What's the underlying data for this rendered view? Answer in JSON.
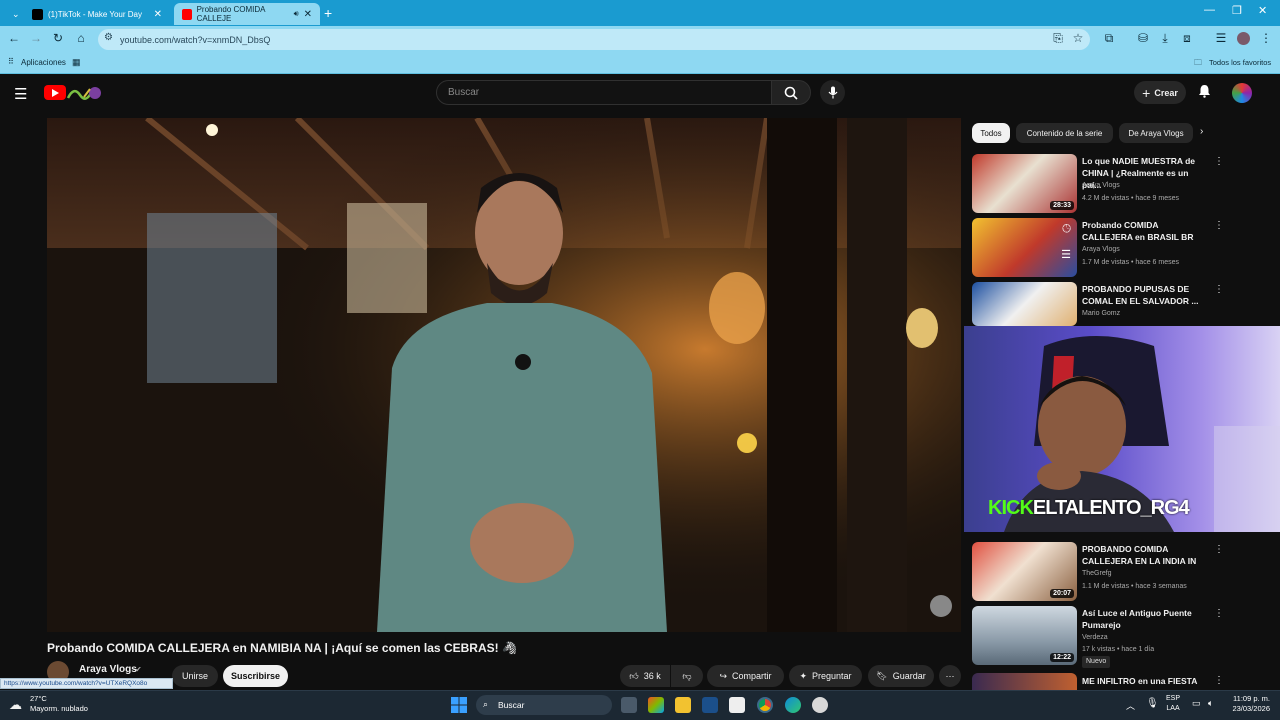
{
  "browser": {
    "tabs": [
      {
        "title": "(1)TikTok - Make Your Day",
        "active": false
      },
      {
        "title": "Probando COMIDA CALLEJE",
        "active": true
      }
    ],
    "url": "youtube.com/watch?v=xnmDN_DbsQ",
    "bookmarks": {
      "apps_label": "Aplicaciones",
      "favorites_label": "Todos los favoritos"
    }
  },
  "youtube": {
    "search_placeholder": "Buscar",
    "create_label": "Crear",
    "video": {
      "title": "Probando COMIDA CALLEJERA en NAMIBIA NA | ¡Aquí se comen las CEBRAS! 🦓",
      "channel": "Araya Vlogs",
      "join_label": "Unirse",
      "subscribe_label": "Suscribirse",
      "likes": "36 k",
      "share_label": "Compartir",
      "ask_label": "Preguntar",
      "save_label": "Guardar"
    },
    "hover_link": "https://www.youtube.com/watch?v=UTXeRQXo8o",
    "chips": [
      "Todos",
      "Contenido de la serie",
      "De Araya Vlogs"
    ],
    "related": [
      {
        "title": "Lo que NADIE MUESTRA de CHINA | ¿Realmente es un paí...",
        "channel": "Araya Vlogs",
        "meta": "4.2 M de vistas • hace 9 meses",
        "duration": "28:33"
      },
      {
        "title": "Probando COMIDA CALLEJERA en BRASIL BR",
        "channel": "Araya Vlogs",
        "meta": "1.7 M de vistas • hace 6 meses",
        "duration": ""
      },
      {
        "title": "PROBANDO PUPUSAS DE COMAL EN EL SALVADOR ...",
        "channel": "Mario Gomz",
        "meta": "",
        "duration": ""
      },
      {
        "title": "PROBANDO COMIDA CALLEJERA EN LA INDIA IN",
        "channel": "TheGrefg",
        "meta": "1.1 M de vistas • hace 3 semanas",
        "duration": "20:07"
      },
      {
        "title": "Así Luce el Antiguo Puente Pumarejo",
        "channel": "Verdeza",
        "meta": "17 k vistas • hace 1 día",
        "duration": "12:22",
        "badge": "Nuevo"
      },
      {
        "title": "ME INFILTRO en una FIESTA",
        "channel": "",
        "meta": "",
        "duration": ""
      }
    ]
  },
  "overlay": {
    "kick": "KICK",
    "handle": "ELTALENTO_RG4"
  },
  "taskbar": {
    "weather_temp": "27°C",
    "weather_desc": "Mayorm. nublado",
    "search_label": "Buscar",
    "lang1": "ESP",
    "lang2": "LAA",
    "time": "11:09 p. m.",
    "date": "23/03/2026"
  },
  "colors": {
    "youtube_red": "#ff0000",
    "chrome_tab": "#1a9bd0",
    "toolbar": "#8ed8f2",
    "bg": "#0f0f0f"
  }
}
